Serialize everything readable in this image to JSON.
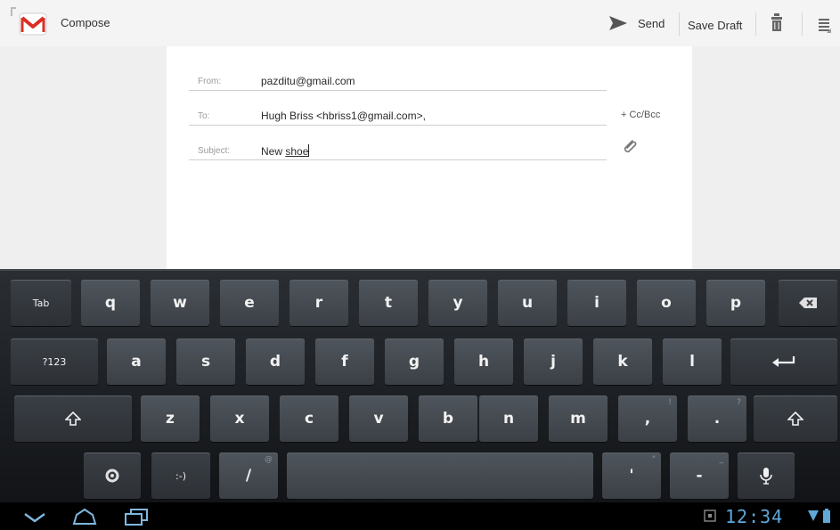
{
  "action_bar": {
    "title": "Compose",
    "send_label": "Send",
    "save_draft_label": "Save Draft",
    "icons": [
      "gmail-icon",
      "send-icon",
      "trash-icon",
      "menu-icon"
    ]
  },
  "form": {
    "from": {
      "label": "From:",
      "value": "pazditu@gmail.com"
    },
    "to": {
      "label": "To:",
      "value": "Hugh Briss <hbriss1@gmail.com>,"
    },
    "subject": {
      "label": "Subject:",
      "value_plain": "New ",
      "value_underlined": "shoe"
    },
    "cc_bcc_label": "+ Cc/Bcc"
  },
  "keyboard": {
    "row1": [
      "Tab",
      "q",
      "w",
      "e",
      "r",
      "t",
      "y",
      "u",
      "i",
      "o",
      "p"
    ],
    "row2": [
      "?123",
      "a",
      "s",
      "d",
      "f",
      "g",
      "h",
      "j",
      "k",
      "l"
    ],
    "row3": [
      "z",
      "x",
      "c",
      "v",
      "b",
      "n",
      "m",
      ",",
      "."
    ],
    "row3_hints": [
      "!",
      "?"
    ],
    "row4": [
      ":-)",
      "/",
      "'",
      "-"
    ],
    "row4_hints": [
      "@",
      "\"",
      "_"
    ]
  },
  "system_bar": {
    "clock": "12:34"
  },
  "colors": {
    "gmail_red": "#d93025",
    "clock": "#5fa8d8",
    "keyboard_bg": "#1b1e22",
    "key_bg": "#464c52"
  }
}
